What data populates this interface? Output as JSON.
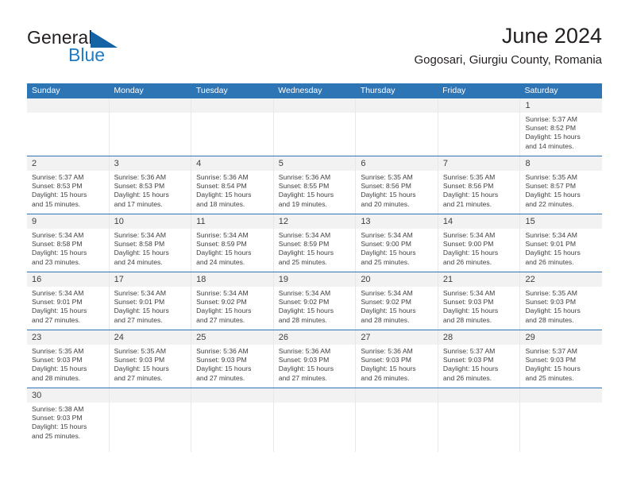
{
  "brand": {
    "name_line1": "General",
    "name_line2": "Blue",
    "flag_icon": "blue-flag-triangle",
    "color_dark": "#231f20",
    "color_blue": "#1e7bc4"
  },
  "header": {
    "title": "June 2024",
    "subtitle": "Gogosari, Giurgiu County, Romania"
  },
  "colors": {
    "header_bar": "#2e75b6",
    "daynum_band": "#f2f2f2",
    "text": "#3f3f3f",
    "cell_divider": "#e8e8e8"
  },
  "weekday_headers": [
    "Sunday",
    "Monday",
    "Tuesday",
    "Wednesday",
    "Thursday",
    "Friday",
    "Saturday"
  ],
  "labels": {
    "sunrise_prefix": "Sunrise:",
    "sunset_prefix": "Sunset:",
    "daylight_prefix": "Daylight:"
  },
  "weeks": [
    [
      {
        "day": "",
        "empty": true
      },
      {
        "day": "",
        "empty": true
      },
      {
        "day": "",
        "empty": true
      },
      {
        "day": "",
        "empty": true
      },
      {
        "day": "",
        "empty": true
      },
      {
        "day": "",
        "empty": true
      },
      {
        "day": "1",
        "sunrise": "Sunrise: 5:37 AM",
        "sunset": "Sunset: 8:52 PM",
        "daylight1": "Daylight: 15 hours",
        "daylight2": "and 14 minutes."
      }
    ],
    [
      {
        "day": "2",
        "sunrise": "Sunrise: 5:37 AM",
        "sunset": "Sunset: 8:53 PM",
        "daylight1": "Daylight: 15 hours",
        "daylight2": "and 15 minutes."
      },
      {
        "day": "3",
        "sunrise": "Sunrise: 5:36 AM",
        "sunset": "Sunset: 8:53 PM",
        "daylight1": "Daylight: 15 hours",
        "daylight2": "and 17 minutes."
      },
      {
        "day": "4",
        "sunrise": "Sunrise: 5:36 AM",
        "sunset": "Sunset: 8:54 PM",
        "daylight1": "Daylight: 15 hours",
        "daylight2": "and 18 minutes."
      },
      {
        "day": "5",
        "sunrise": "Sunrise: 5:36 AM",
        "sunset": "Sunset: 8:55 PM",
        "daylight1": "Daylight: 15 hours",
        "daylight2": "and 19 minutes."
      },
      {
        "day": "6",
        "sunrise": "Sunrise: 5:35 AM",
        "sunset": "Sunset: 8:56 PM",
        "daylight1": "Daylight: 15 hours",
        "daylight2": "and 20 minutes."
      },
      {
        "day": "7",
        "sunrise": "Sunrise: 5:35 AM",
        "sunset": "Sunset: 8:56 PM",
        "daylight1": "Daylight: 15 hours",
        "daylight2": "and 21 minutes."
      },
      {
        "day": "8",
        "sunrise": "Sunrise: 5:35 AM",
        "sunset": "Sunset: 8:57 PM",
        "daylight1": "Daylight: 15 hours",
        "daylight2": "and 22 minutes."
      }
    ],
    [
      {
        "day": "9",
        "sunrise": "Sunrise: 5:34 AM",
        "sunset": "Sunset: 8:58 PM",
        "daylight1": "Daylight: 15 hours",
        "daylight2": "and 23 minutes."
      },
      {
        "day": "10",
        "sunrise": "Sunrise: 5:34 AM",
        "sunset": "Sunset: 8:58 PM",
        "daylight1": "Daylight: 15 hours",
        "daylight2": "and 24 minutes."
      },
      {
        "day": "11",
        "sunrise": "Sunrise: 5:34 AM",
        "sunset": "Sunset: 8:59 PM",
        "daylight1": "Daylight: 15 hours",
        "daylight2": "and 24 minutes."
      },
      {
        "day": "12",
        "sunrise": "Sunrise: 5:34 AM",
        "sunset": "Sunset: 8:59 PM",
        "daylight1": "Daylight: 15 hours",
        "daylight2": "and 25 minutes."
      },
      {
        "day": "13",
        "sunrise": "Sunrise: 5:34 AM",
        "sunset": "Sunset: 9:00 PM",
        "daylight1": "Daylight: 15 hours",
        "daylight2": "and 25 minutes."
      },
      {
        "day": "14",
        "sunrise": "Sunrise: 5:34 AM",
        "sunset": "Sunset: 9:00 PM",
        "daylight1": "Daylight: 15 hours",
        "daylight2": "and 26 minutes."
      },
      {
        "day": "15",
        "sunrise": "Sunrise: 5:34 AM",
        "sunset": "Sunset: 9:01 PM",
        "daylight1": "Daylight: 15 hours",
        "daylight2": "and 26 minutes."
      }
    ],
    [
      {
        "day": "16",
        "sunrise": "Sunrise: 5:34 AM",
        "sunset": "Sunset: 9:01 PM",
        "daylight1": "Daylight: 15 hours",
        "daylight2": "and 27 minutes."
      },
      {
        "day": "17",
        "sunrise": "Sunrise: 5:34 AM",
        "sunset": "Sunset: 9:01 PM",
        "daylight1": "Daylight: 15 hours",
        "daylight2": "and 27 minutes."
      },
      {
        "day": "18",
        "sunrise": "Sunrise: 5:34 AM",
        "sunset": "Sunset: 9:02 PM",
        "daylight1": "Daylight: 15 hours",
        "daylight2": "and 27 minutes."
      },
      {
        "day": "19",
        "sunrise": "Sunrise: 5:34 AM",
        "sunset": "Sunset: 9:02 PM",
        "daylight1": "Daylight: 15 hours",
        "daylight2": "and 28 minutes."
      },
      {
        "day": "20",
        "sunrise": "Sunrise: 5:34 AM",
        "sunset": "Sunset: 9:02 PM",
        "daylight1": "Daylight: 15 hours",
        "daylight2": "and 28 minutes."
      },
      {
        "day": "21",
        "sunrise": "Sunrise: 5:34 AM",
        "sunset": "Sunset: 9:03 PM",
        "daylight1": "Daylight: 15 hours",
        "daylight2": "and 28 minutes."
      },
      {
        "day": "22",
        "sunrise": "Sunrise: 5:35 AM",
        "sunset": "Sunset: 9:03 PM",
        "daylight1": "Daylight: 15 hours",
        "daylight2": "and 28 minutes."
      }
    ],
    [
      {
        "day": "23",
        "sunrise": "Sunrise: 5:35 AM",
        "sunset": "Sunset: 9:03 PM",
        "daylight1": "Daylight: 15 hours",
        "daylight2": "and 28 minutes."
      },
      {
        "day": "24",
        "sunrise": "Sunrise: 5:35 AM",
        "sunset": "Sunset: 9:03 PM",
        "daylight1": "Daylight: 15 hours",
        "daylight2": "and 27 minutes."
      },
      {
        "day": "25",
        "sunrise": "Sunrise: 5:36 AM",
        "sunset": "Sunset: 9:03 PM",
        "daylight1": "Daylight: 15 hours",
        "daylight2": "and 27 minutes."
      },
      {
        "day": "26",
        "sunrise": "Sunrise: 5:36 AM",
        "sunset": "Sunset: 9:03 PM",
        "daylight1": "Daylight: 15 hours",
        "daylight2": "and 27 minutes."
      },
      {
        "day": "27",
        "sunrise": "Sunrise: 5:36 AM",
        "sunset": "Sunset: 9:03 PM",
        "daylight1": "Daylight: 15 hours",
        "daylight2": "and 26 minutes."
      },
      {
        "day": "28",
        "sunrise": "Sunrise: 5:37 AM",
        "sunset": "Sunset: 9:03 PM",
        "daylight1": "Daylight: 15 hours",
        "daylight2": "and 26 minutes."
      },
      {
        "day": "29",
        "sunrise": "Sunrise: 5:37 AM",
        "sunset": "Sunset: 9:03 PM",
        "daylight1": "Daylight: 15 hours",
        "daylight2": "and 25 minutes."
      }
    ],
    [
      {
        "day": "30",
        "sunrise": "Sunrise: 5:38 AM",
        "sunset": "Sunset: 9:03 PM",
        "daylight1": "Daylight: 15 hours",
        "daylight2": "and 25 minutes."
      },
      {
        "day": "",
        "empty": true
      },
      {
        "day": "",
        "empty": true
      },
      {
        "day": "",
        "empty": true
      },
      {
        "day": "",
        "empty": true
      },
      {
        "day": "",
        "empty": true
      },
      {
        "day": "",
        "empty": true
      }
    ]
  ]
}
